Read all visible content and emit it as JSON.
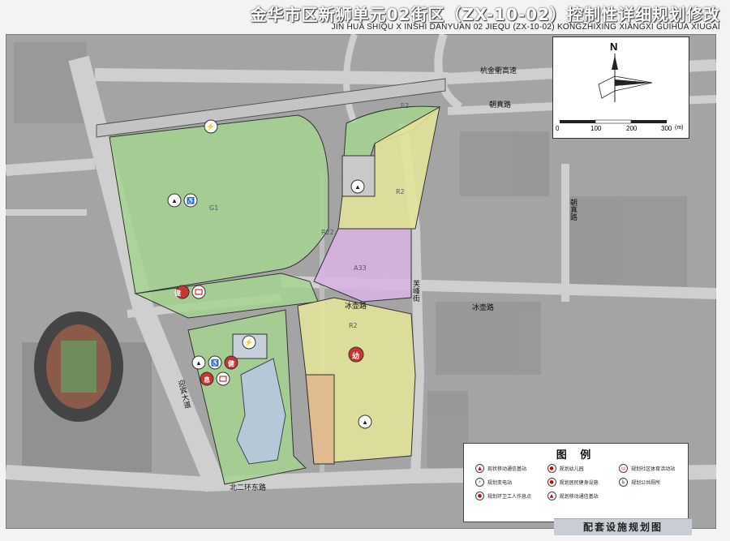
{
  "title": {
    "cn": "金华市区新狮单元02街区（ZX-10-02）控制性详细规划修改",
    "en": "JIN HUA SHIQU  X INSHI  DANYUAN 02 JIEQU  (ZX-10-02)  KONGZHIXING  XIANGXI  GUIHUA  XIUGAI"
  },
  "roads": {
    "expressway": "杭金衢高速",
    "chaozhen_top": "朝真路",
    "chaozhen_right": "朝真路",
    "binghu_left": "冰壶路",
    "binghu_right": "冰壶路",
    "furong": "芙峰街",
    "yingbin": "迎宾大道",
    "beierhuan": "北二环东路"
  },
  "parcel_codes": {
    "g1": "G1",
    "e2_top": "E2",
    "r2_a": "R2",
    "r2_b": "R2",
    "a33": "A33",
    "r22": "R22"
  },
  "compass": {
    "north": "N",
    "scale_ticks": [
      "0",
      "100",
      "200",
      "300"
    ],
    "scale_unit": "(m)"
  },
  "map_icons": {
    "kindergarten_char": "幼",
    "fitness_char": "健",
    "rest_char": "息"
  },
  "legend": {
    "title": "图  例",
    "items": [
      [
        "现状移动通信基站",
        "规划幼儿园",
        "规划社区体育活动站"
      ],
      [
        "规划变电站",
        "规划居民健身设施",
        "规划公共厕所"
      ],
      [
        "规划环卫工人作息点",
        "规划移动通信基站",
        ""
      ]
    ]
  },
  "footer": "配套设施规划图",
  "colors": {
    "green": "#a6d590",
    "yellow": "#e3e39a",
    "purple": "#d7b3e0",
    "orange": "#dfb88e",
    "water": "#b5c8d8",
    "road": "#c9c9c9",
    "base": "#9e9e9e"
  }
}
